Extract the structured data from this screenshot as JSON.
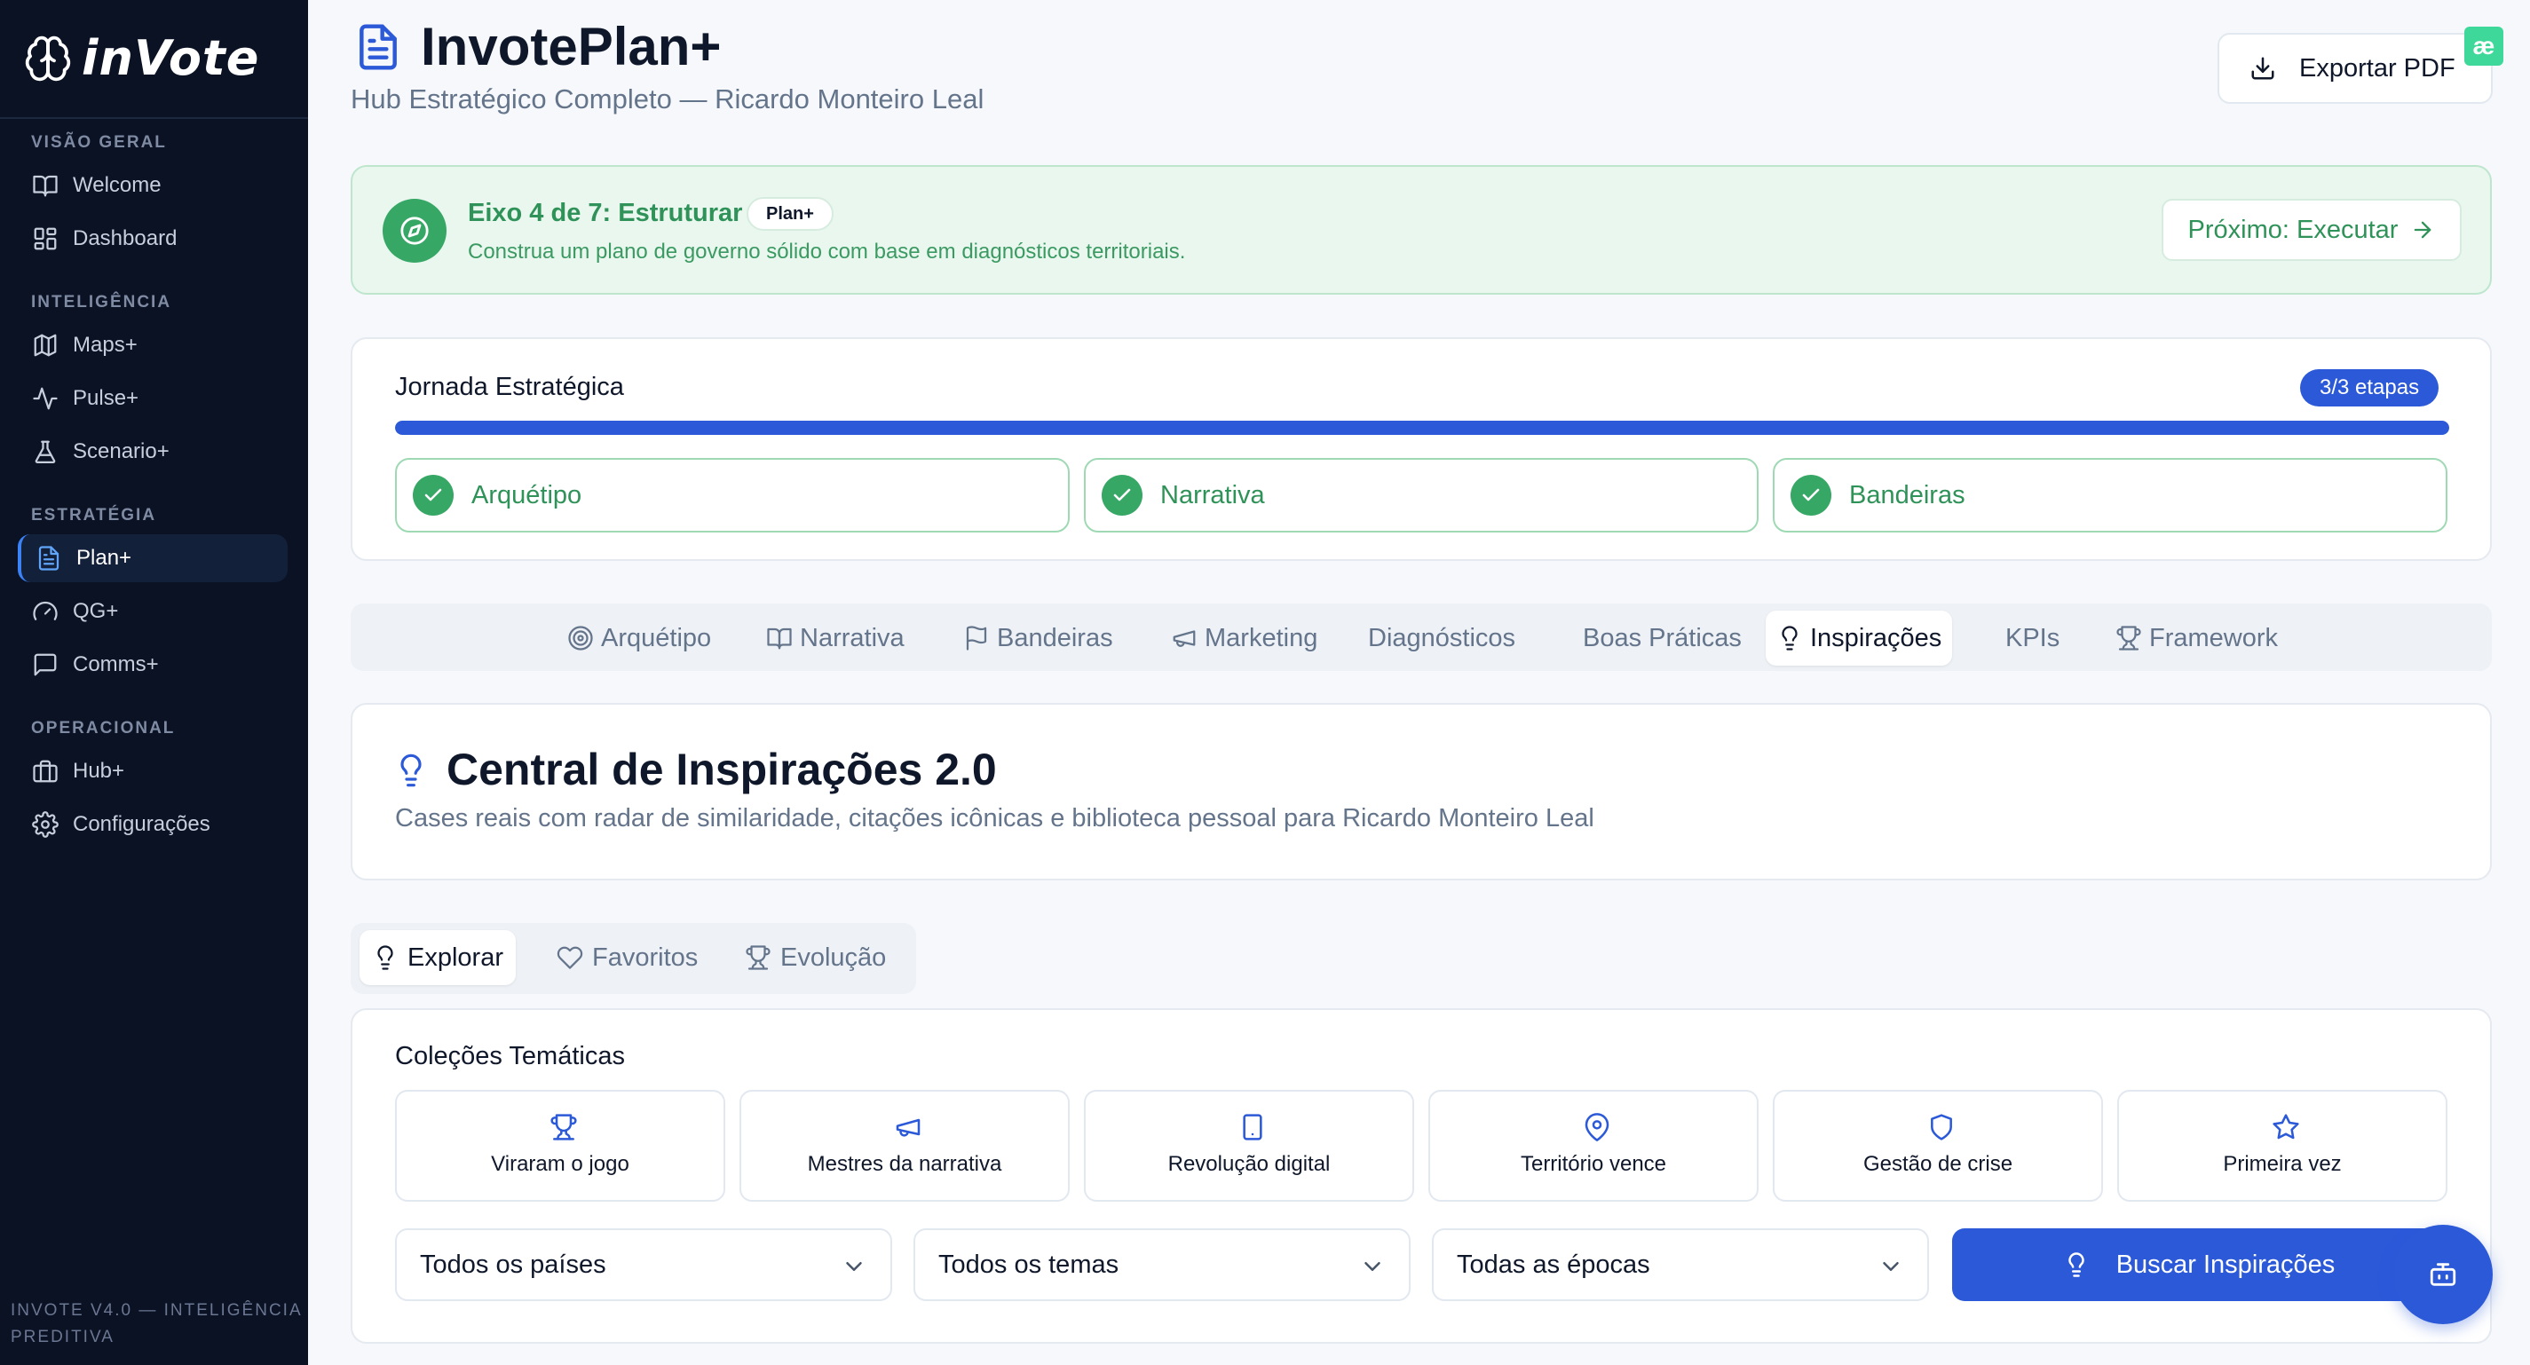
{
  "app": {
    "logo_text": "inVote"
  },
  "sidebar": {
    "sections": [
      {
        "title": "VISÃO GERAL"
      },
      {
        "title": "INTELIGÊNCIA"
      },
      {
        "title": "ESTRATÉGIA"
      },
      {
        "title": "OPERACIONAL"
      }
    ],
    "items": [
      {
        "label": "Welcome",
        "icon": "book-icon"
      },
      {
        "label": "Dashboard",
        "icon": "grid-icon"
      },
      {
        "label": "Maps+",
        "icon": "map-icon"
      },
      {
        "label": "Pulse+",
        "icon": "activity-icon"
      },
      {
        "label": "Scenario+",
        "icon": "flask-icon"
      },
      {
        "label": "Plan+",
        "icon": "file-icon",
        "active": true
      },
      {
        "label": "QG+",
        "icon": "gauge-icon"
      },
      {
        "label": "Comms+",
        "icon": "message-icon"
      },
      {
        "label": "Hub+",
        "icon": "building-icon"
      },
      {
        "label": "Configurações",
        "icon": "gear-icon"
      }
    ],
    "footer": "INVOTE V4.0 — INTELIGÊNCIA PREDITIVA"
  },
  "header": {
    "title": "InvotePlan+",
    "subtitle": "Hub Estratégico Completo — Ricardo Monteiro Leal",
    "export_label": "Exportar PDF",
    "corner_badge": "æ"
  },
  "banner": {
    "title": "Eixo 4 de 7: Estruturar",
    "pill": "Plan+",
    "description": "Construa um plano de governo sólido com base em diagnósticos territoriais.",
    "next_label": "Próximo: Executar"
  },
  "journey": {
    "title": "Jornada Estratégica",
    "badge": "3/3 etapas",
    "progress": 1.0,
    "steps": [
      {
        "label": "Arquétipo"
      },
      {
        "label": "Narrativa"
      },
      {
        "label": "Bandeiras"
      }
    ]
  },
  "tabs": [
    {
      "label": "Arquétipo",
      "icon": "target-icon"
    },
    {
      "label": "Narrativa",
      "icon": "book-open-icon"
    },
    {
      "label": "Bandeiras",
      "icon": "flag-icon"
    },
    {
      "label": "Marketing",
      "icon": "megaphone-icon"
    },
    {
      "label": "Diagnósticos",
      "icon": ""
    },
    {
      "label": "Boas Práticas",
      "icon": ""
    },
    {
      "label": "Inspirações",
      "icon": "lightbulb-icon",
      "active": true
    },
    {
      "label": "KPIs",
      "icon": ""
    },
    {
      "label": "Framework",
      "icon": "trophy-icon"
    }
  ],
  "inspirations": {
    "title": "Central de Inspirações 2.0",
    "description": "Cases reais com radar de similaridade, citações icônicas e biblioteca pessoal para Ricardo Monteiro Leal"
  },
  "subtabs": [
    {
      "label": "Explorar",
      "icon": "lightbulb-icon",
      "active": true
    },
    {
      "label": "Favoritos",
      "icon": "heart-icon"
    },
    {
      "label": "Evolução",
      "icon": "trophy-icon"
    }
  ],
  "collections": {
    "title": "Coleções Temáticas",
    "items": [
      {
        "label": "Viraram o jogo",
        "icon": "trophy-icon"
      },
      {
        "label": "Mestres da narrativa",
        "icon": "megaphone-icon"
      },
      {
        "label": "Revolução digital",
        "icon": "smartphone-icon"
      },
      {
        "label": "Território vence",
        "icon": "map-pin-icon"
      },
      {
        "label": "Gestão de crise",
        "icon": "shield-icon"
      },
      {
        "label": "Primeira vez",
        "icon": "star-icon"
      }
    ]
  },
  "filters": {
    "country": "Todos os países",
    "theme": "Todos os temas",
    "era": "Todas as épocas",
    "search_label": "Buscar Inspirações"
  },
  "colors": {
    "sidebar_bg": "#0a1224",
    "primary": "#2b59d8",
    "success": "#36a764",
    "success_bg": "#e9f7ef"
  }
}
